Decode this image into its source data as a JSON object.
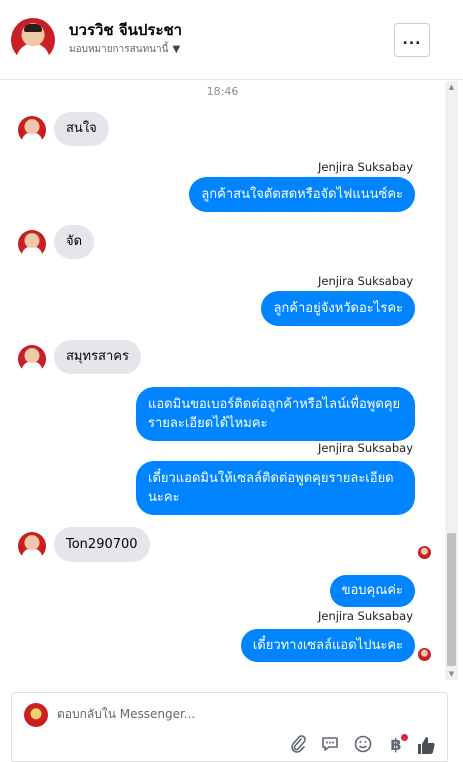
{
  "header": {
    "name": "บวรวิช จีนประชา",
    "subtitle": "มอบหมายการสนทนานี้",
    "more_label": "..."
  },
  "chat": {
    "time": "18:46",
    "messages": [
      {
        "dir": "in",
        "text": "สนใจ"
      },
      {
        "dir": "out",
        "sender": "Jenjira Suksabay",
        "text": "ลูกค้าสนใจตัดสดหรือจัดไฟแนนซ์คะ"
      },
      {
        "dir": "in",
        "text": "จัด"
      },
      {
        "dir": "out",
        "sender": "Jenjira Suksabay",
        "text": "ลูกค้าอยู่จังหวัดอะไรคะ"
      },
      {
        "dir": "in",
        "text": "สมุทรสาคร"
      },
      {
        "dir": "out",
        "text": "แอดมินขอเบอร์ติดต่อลูกค้าหรือไลน์เพื่อพูดคุยรายละเอียดได้ไหมคะ"
      },
      {
        "dir": "out",
        "sender": "Jenjira Suksabay",
        "text": "เดี๋ยวแอดมินให้เซลล์ติดต่อพูดคุยรายละเอียดนะคะ"
      },
      {
        "dir": "in",
        "text": "Ton290700"
      },
      {
        "dir": "out",
        "text": "ขอบคุณค่ะ"
      },
      {
        "dir": "out",
        "sender": "Jenjira Suksabay",
        "text": "เดี๋ยวทางเซลล์แอดไปนะคะ"
      }
    ]
  },
  "composer": {
    "placeholder": "ตอบกลับใน Messenger...",
    "tools": [
      "paperclip-icon",
      "speech-bubble-icon",
      "emoji-icon",
      "currency-icon",
      "thumbs-up-icon"
    ]
  },
  "colors": {
    "outgoing_bubble": "#0084ff",
    "incoming_bubble": "#e4e6eb",
    "notification_dot": "#e41e3f"
  }
}
